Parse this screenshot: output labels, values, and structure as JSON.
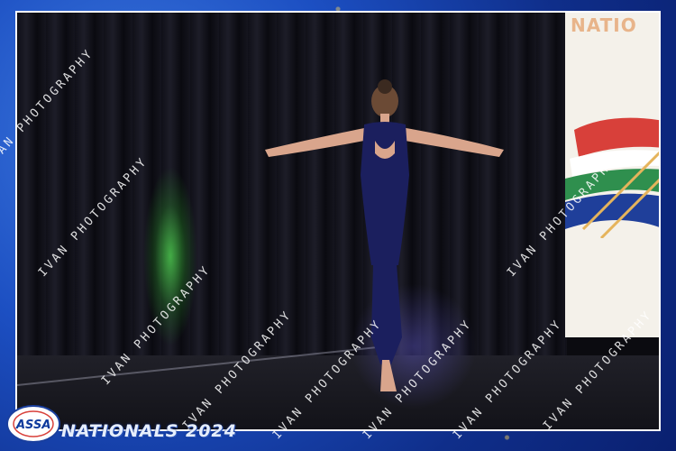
{
  "banner": {
    "text": "NATIO"
  },
  "logo": {
    "text": "ASSA"
  },
  "event": {
    "title": "NATIONALS 2024"
  },
  "watermark": {
    "text": "IVAN PHOTOGRAPHY"
  },
  "colors": {
    "frame_blue": "#1c4fc2",
    "stage_black": "#0b0b10",
    "costume_navy": "#1b1f5e",
    "flag_red": "#d8403a",
    "flag_green": "#2f8f4e",
    "flag_blue": "#1f3f9a"
  }
}
